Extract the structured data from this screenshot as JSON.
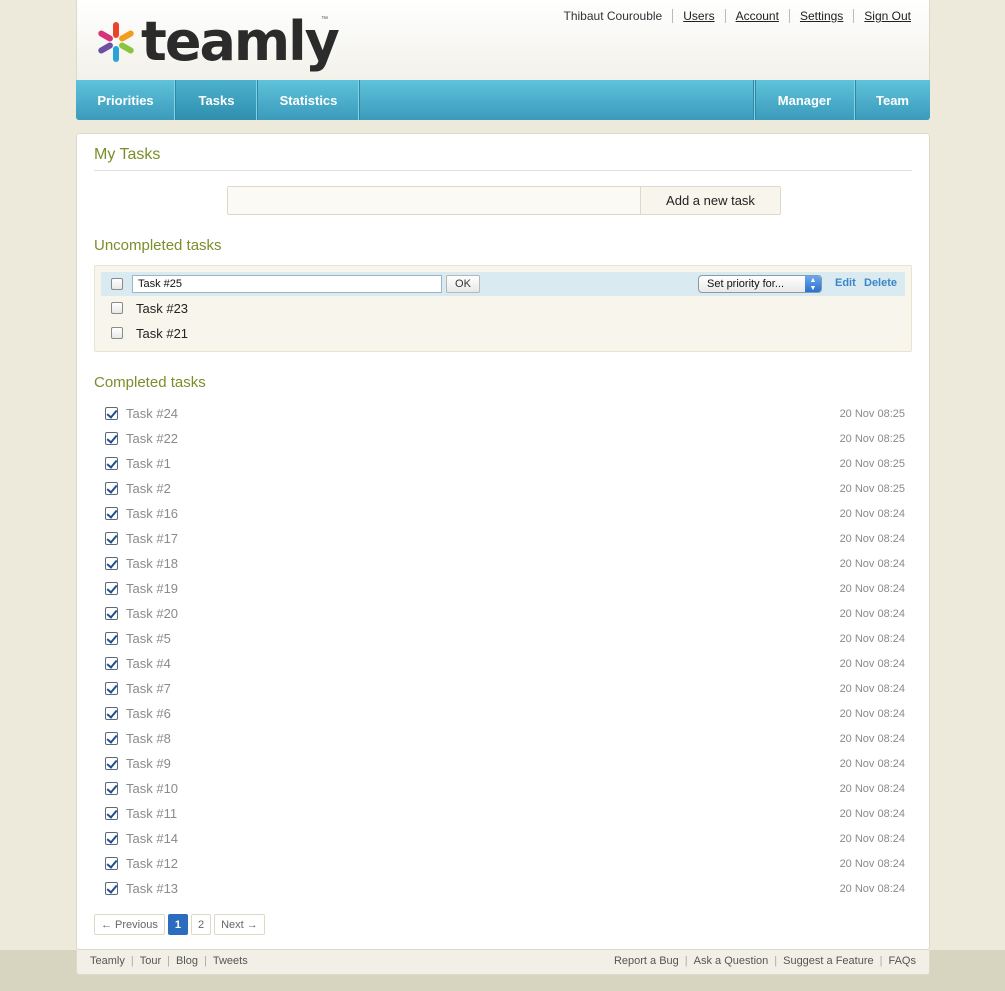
{
  "brand": {
    "name": "teamly",
    "tm": "™"
  },
  "userbar": {
    "username": "Thibaut Courouble",
    "links": [
      "Users",
      "Account",
      "Settings",
      "Sign Out"
    ]
  },
  "nav": {
    "left": [
      "Priorities",
      "Tasks",
      "Statistics"
    ],
    "right": [
      "Manager",
      "Team"
    ],
    "active": "Tasks"
  },
  "main": {
    "title": "My Tasks",
    "add": {
      "placeholder": "",
      "button": "Add a new task"
    },
    "uncompleted_heading": "Uncompleted tasks",
    "editing": {
      "value": "Task #25",
      "ok": "OK",
      "priority": "Set priority for...",
      "edit": "Edit",
      "delete": "Delete"
    },
    "uncompleted": [
      "Task #23",
      "Task #21"
    ],
    "completed_heading": "Completed tasks",
    "completed": [
      {
        "name": "Task #24",
        "date": "20 Nov 08:25"
      },
      {
        "name": "Task #22",
        "date": "20 Nov 08:25"
      },
      {
        "name": "Task #1",
        "date": "20 Nov 08:25"
      },
      {
        "name": "Task #2",
        "date": "20 Nov 08:25"
      },
      {
        "name": "Task #16",
        "date": "20 Nov 08:24"
      },
      {
        "name": "Task #17",
        "date": "20 Nov 08:24"
      },
      {
        "name": "Task #18",
        "date": "20 Nov 08:24"
      },
      {
        "name": "Task #19",
        "date": "20 Nov 08:24"
      },
      {
        "name": "Task #20",
        "date": "20 Nov 08:24"
      },
      {
        "name": "Task #5",
        "date": "20 Nov 08:24"
      },
      {
        "name": "Task #4",
        "date": "20 Nov 08:24"
      },
      {
        "name": "Task #7",
        "date": "20 Nov 08:24"
      },
      {
        "name": "Task #6",
        "date": "20 Nov 08:24"
      },
      {
        "name": "Task #8",
        "date": "20 Nov 08:24"
      },
      {
        "name": "Task #9",
        "date": "20 Nov 08:24"
      },
      {
        "name": "Task #10",
        "date": "20 Nov 08:24"
      },
      {
        "name": "Task #11",
        "date": "20 Nov 08:24"
      },
      {
        "name": "Task #14",
        "date": "20 Nov 08:24"
      },
      {
        "name": "Task #12",
        "date": "20 Nov 08:24"
      },
      {
        "name": "Task #13",
        "date": "20 Nov 08:24"
      }
    ],
    "pager": {
      "prev": "← Previous",
      "pages": [
        "1",
        "2"
      ],
      "current": "1",
      "next": "Next →"
    }
  },
  "footer": {
    "left": [
      "Teamly",
      "Tour",
      "Blog",
      "Tweets"
    ],
    "right": [
      "Report a Bug",
      "Ask a Question",
      "Suggest a Feature",
      "FAQs"
    ]
  },
  "colors": {
    "accent": "#7a8e2a",
    "nav": "#4cb2cc",
    "link": "#3a86c8",
    "current_page": "#2b6cbf"
  }
}
